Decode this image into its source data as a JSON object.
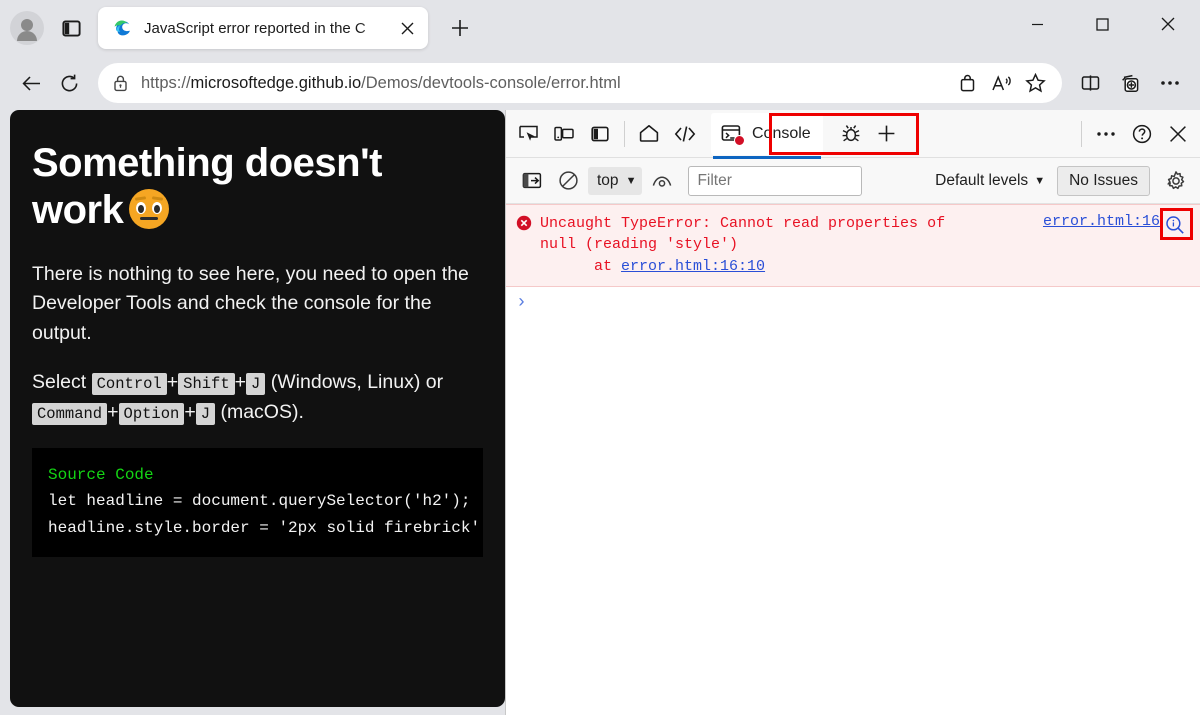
{
  "browser": {
    "tab": {
      "title": "JavaScript error reported in the C",
      "favicon_icon": "edge-logo-icon",
      "close_icon": "close-icon"
    },
    "new_tab_label": "+",
    "avatar_icon": "profile-avatar-icon",
    "tab_actions_icon": "tab-actions-icon",
    "window_controls": {
      "minimize": "—",
      "maximize": "□",
      "close": "✕"
    },
    "nav": {
      "back_icon": "back-arrow-icon",
      "refresh_icon": "refresh-icon",
      "lock_icon": "lock-icon",
      "url_scheme": "https://",
      "url_host": "microsoftedge.github.io",
      "url_path": "/Demos/devtools-console/error.html",
      "url_full": "https://microsoftedge.github.io/Demos/devtools-console/error.html",
      "shopping_icon": "shopping-bag-icon",
      "read_aloud_icon": "read-aloud-icon",
      "favorite_icon": "star-icon",
      "split_screen_icon": "split-screen-icon",
      "collections_icon": "collections-icon",
      "settings_icon": "more-options-icon"
    }
  },
  "page": {
    "heading": "Something doesn't work",
    "heading_emoji": "face-with-raised-eyebrow-emoji",
    "paragraph": "There is nothing to see here, you need to open the Developer Tools and check the console for the output.",
    "shortcut_prefix": "Select",
    "shortcut_windows": {
      "keys": [
        "Control",
        "Shift",
        "J"
      ],
      "platform": "(Windows, Linux) or"
    },
    "shortcut_mac": {
      "keys": [
        "Command",
        "Option",
        "J"
      ],
      "platform": "(macOS)."
    },
    "plus": "+",
    "code": {
      "title": "Source Code",
      "line1": "let headline = document.querySelector('h2');",
      "line2": "headline.style.border = '2px solid firebrick'"
    }
  },
  "devtools": {
    "tabbar": {
      "inspect_icon": "inspect-element-icon",
      "device_icon": "device-emulation-icon",
      "dock_icon": "dock-side-icon",
      "home_icon": "home-icon",
      "elements_icon": "elements-code-icon",
      "console_tab_label": "Console",
      "console_tab_icon": "console-error-icon",
      "debug_icon": "bug-icon",
      "more_tabs_icon": "plus-icon",
      "more_options_icon": "more-options-icon",
      "help_icon": "help-icon",
      "close_icon": "close-devtools-icon"
    },
    "toolbar": {
      "sidebar_icon": "console-sidebar-icon",
      "clear_icon": "clear-console-icon",
      "context_label": "top",
      "context_caret": "▼",
      "live_expression_icon": "eye-icon",
      "filter_placeholder": "Filter",
      "filter_value": "",
      "levels_label": "Default levels",
      "levels_caret": "▼",
      "issues_label": "No Issues",
      "settings_icon": "gear-icon"
    },
    "console": {
      "error": {
        "icon": "error-circle-icon",
        "message_line1": "Uncaught TypeError: Cannot read properties of",
        "message_line2": "null (reading 'style')",
        "stack_prefix": "at ",
        "stack_link": "error.html:16:10",
        "source_link": "error.html:16",
        "explain_icon": "magnifier-info-icon"
      },
      "prompt_caret": "›"
    }
  },
  "highlights": {
    "accent": "#ee0000",
    "error_text": "#e81123",
    "link": "#2a4fd7",
    "tab_underline": "#0d65c1"
  }
}
